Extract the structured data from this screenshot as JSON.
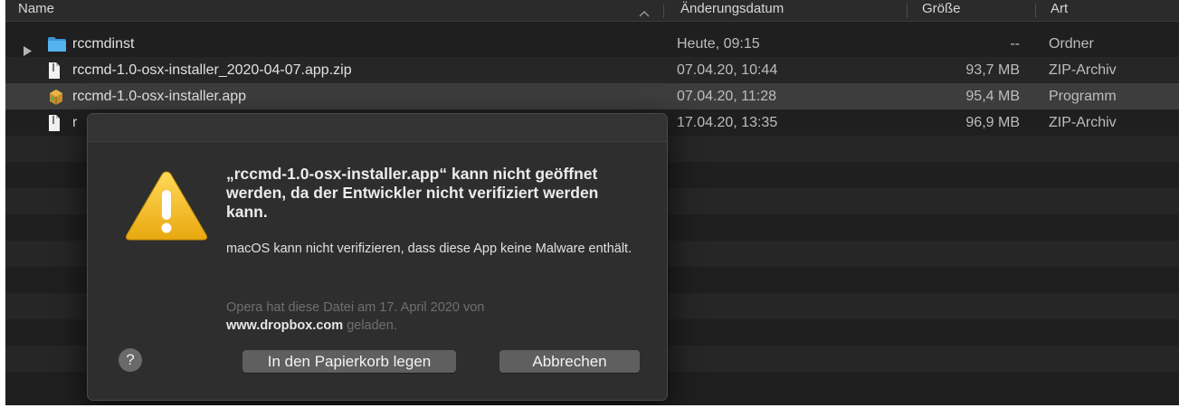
{
  "columns": {
    "name": "Name",
    "date": "Änderungsdatum",
    "size": "Größe",
    "kind": "Art"
  },
  "rows": [
    {
      "icon": "folder-icon",
      "name": "rccmdinst",
      "date": "Heute, 09:15",
      "size": "--",
      "kind": "Ordner"
    },
    {
      "icon": "zip-file-icon",
      "name": "rccmd-1.0-osx-installer_2020-04-07.app.zip",
      "date": "07.04.20, 10:44",
      "size": "93,7 MB",
      "kind": "ZIP-Archiv"
    },
    {
      "icon": "app-icon",
      "name": "rccmd-1.0-osx-installer.app",
      "date": "07.04.20, 11:28",
      "size": "95,4 MB",
      "kind": "Programm"
    },
    {
      "icon": "zip-file-icon",
      "name": "r",
      "date": "17.04.20, 13:35",
      "size": "96,9 MB",
      "kind": "ZIP-Archiv"
    }
  ],
  "dialog": {
    "title": "„rccmd-1.0-osx-installer.app“ kann nicht geöffnet werden, da der Entwickler nicht verifiziert werden kann.",
    "body": "macOS kann nicht verifizieren, dass diese App keine Malware enthält.",
    "note_prefix": "Opera hat diese Datei am 17. April 2020 von",
    "note_source": "www.dropbox.com",
    "note_suffix": "geladen.",
    "help_label": "?",
    "trash_button": "In den Papierkorb legen",
    "cancel_button": "Abbrechen"
  },
  "colors": {
    "background": "#1f1f1f",
    "row_alt": "#262626",
    "row_selected": "#3d3d3d",
    "dialog": "#2e2e2e",
    "button": "#5f5f5f",
    "warning": "#f2c230",
    "folder": "#4aa6e6"
  }
}
